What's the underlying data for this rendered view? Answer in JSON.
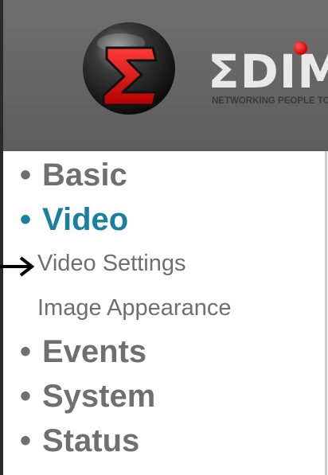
{
  "brand": {
    "name": "ΣDIM",
    "tagline": "NETWORKING PEOPLE TOGETHER",
    "logo_icon": "sigma-sphere-logo"
  },
  "colors": {
    "header_bg": "#666666",
    "nav_text": "#6f6f6f",
    "active_text": "#1b7fa0",
    "logo_red": "#d40000"
  },
  "nav": {
    "bullet": "•",
    "items": [
      {
        "label": "Basic"
      },
      {
        "label": "Video",
        "active": true
      },
      {
        "label": "Events"
      },
      {
        "label": "System"
      },
      {
        "label": "Status"
      }
    ],
    "video_subitems": [
      {
        "label": "Video Settings"
      },
      {
        "label": "Image Appearance"
      }
    ]
  },
  "annotation": {
    "icon": "arrow-right-icon"
  }
}
